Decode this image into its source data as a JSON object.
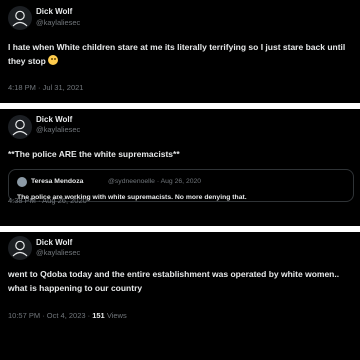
{
  "tweets": [
    {
      "author_name": "Dick Wolf",
      "author_handle": "@kaylaliesec",
      "text": "I hate when White children stare at me its literally terrifying so I just stare back until they stop",
      "emoji": "smiling-face-with-sweat",
      "timestamp": "4:18 PM · Jul 31, 2021"
    },
    {
      "author_name": "Dick Wolf",
      "author_handle": "@kaylaliesec",
      "text": "**The police ARE the white supremacists**",
      "quoted": {
        "author_name": "Teresa Mendoza",
        "author_handle_date": "@sydneenoelle · Aug 26, 2020",
        "text": "The police are working with white supremacists. No more denying that."
      },
      "timestamp": "4:38 PM · Aug 26, 2020"
    },
    {
      "author_name": "Dick Wolf",
      "author_handle": "@kaylaliesec",
      "text": "went to Qdoba today and the entire establishment was operated by white women.. what is happening to our country",
      "timestamp": "10:57 PM · Oct 4, 2023 · ",
      "views_count": "151",
      "views_label": " Views"
    }
  ]
}
